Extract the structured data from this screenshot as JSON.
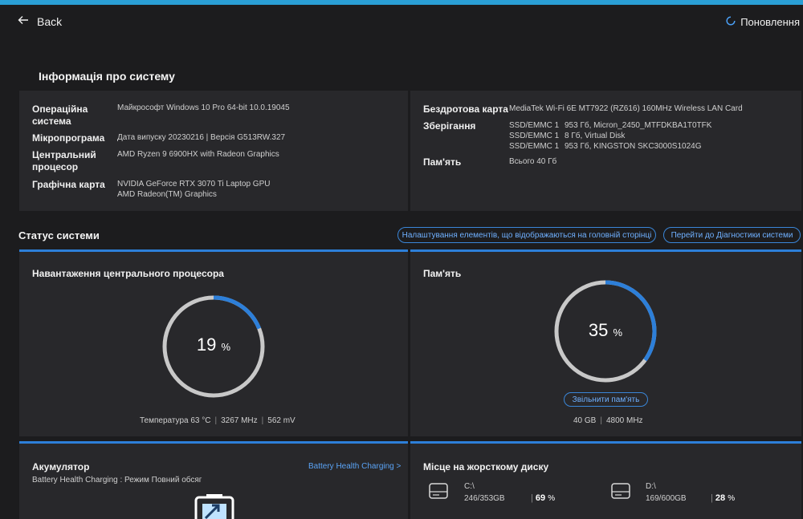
{
  "header": {
    "back_label": "Back",
    "refresh_label": "Поновлення"
  },
  "sysinfo": {
    "title": "Інформація про систему",
    "left": [
      {
        "label": "Операційна система",
        "value": [
          "Майкрософт Windows 10 Pro 64-bit 10.0.19045"
        ]
      },
      {
        "label": "Мікропрограма",
        "value": [
          "Дата випуску 20230216 | Версія G513RW.327"
        ]
      },
      {
        "label": "Центральний процесор",
        "value": [
          "AMD Ryzen 9 6900HX with Radeon Graphics"
        ]
      },
      {
        "label": "Графічна карта",
        "value": [
          "NVIDIA GeForce RTX 3070 Ti Laptop GPU",
          "AMD Radeon(TM) Graphics"
        ]
      }
    ],
    "wireless": {
      "label": "Бездротова карта",
      "value": "MediaTek Wi-Fi 6E MT7922 (RZ616) 160MHz Wireless LAN Card"
    },
    "storage": {
      "label": "Зберігання",
      "drives": [
        {
          "type": "SSD/EMMC 1",
          "desc": "953 Гб, Micron_2450_MTFDKBA1T0TFK"
        },
        {
          "type": "SSD/EMMC 1",
          "desc": "8 Гб, Virtual Disk"
        },
        {
          "type": "SSD/EMMC 1",
          "desc": "953 Гб, KINGSTON SKC3000S1024G"
        }
      ]
    },
    "memory": {
      "label": "Пам'ять",
      "value": "Всього 40 Гб"
    }
  },
  "status": {
    "title": "Статус системи",
    "customize_button": "Налаштування елементів, що відображаються на головній сторінці",
    "diagnostics_button": "Перейти до Діагностики системи"
  },
  "cpu": {
    "title": "Навантаження центрального процесора",
    "percent": 19,
    "percent_text": "19",
    "unit": "%",
    "temperature": "Температура 63 °C",
    "frequency": "3267 MHz",
    "voltage": "562 mV"
  },
  "memory_card": {
    "title": "Пам'ять",
    "percent": 35,
    "percent_text": "35",
    "unit": "%",
    "free_button": "Звільнити пам'ять",
    "total": "40 GB",
    "frequency": "4800 MHz"
  },
  "battery": {
    "title": "Акумулятор",
    "link": "Battery Health Charging >",
    "mode": "Battery Health Charging : Режим Повний обсяг"
  },
  "disk": {
    "title": "Місце на жорсткому диску",
    "drives": [
      {
        "name": "C:\\",
        "usage": "246/353GB",
        "percent": "69",
        "unit": "%"
      },
      {
        "name": "D:\\",
        "usage": "169/600GB",
        "percent": "28",
        "unit": "%"
      }
    ]
  },
  "colors": {
    "accent": "#2d7fd9",
    "gauge_track": "#c8c8c8",
    "background": "#1c1c1e",
    "panel": "#28282b"
  }
}
